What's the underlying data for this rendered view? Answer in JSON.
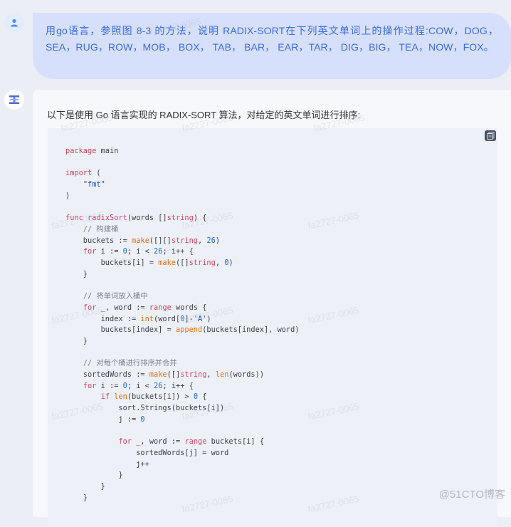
{
  "user_message": {
    "avatar_icon": "user-icon",
    "text": "用go语言，参照图 8-3 的方法，说明 RADIX-SORT在下列英文单词上的操作过程:COW，DOG，SEA，RUG，ROW，MOB， BOX， TAB， BAR， EAR，TAR， DIG，BIG， TEA，NOW，FOX。"
  },
  "bot_message": {
    "avatar_icon": "ai-logo-icon",
    "intro": "以下是使用 Go 语言实现的 RADIX-SORT 算法，对给定的英文单词进行排序:",
    "code": {
      "language": "go",
      "copy_icon": "copy-icon",
      "lines": [
        "package main",
        "",
        "import (",
        "    \"fmt\"",
        ")",
        "",
        "func radixSort(words []string) {",
        "    // 构建桶",
        "    buckets := make([][]string, 26)",
        "    for i := 0; i < 26; i++ {",
        "        buckets[i] = make([]string, 0)",
        "    }",
        "",
        "    // 将单词放入桶中",
        "    for _, word := range words {",
        "        index := int(word[0]-'A')",
        "        buckets[index] = append(buckets[index], word)",
        "    }",
        "",
        "    // 对每个桶进行排序并合并",
        "    sortedWords := make([]string, len(words))",
        "    for i := 0; i < 26; i++ {",
        "        if len(buckets[i]) > 0 {",
        "            sort.Strings(buckets[i])",
        "            j := 0",
        "",
        "            for _, word := range buckets[i] {",
        "                sortedWords[j] = word",
        "                j++",
        "            }",
        "        }",
        "    }"
      ]
    }
  },
  "watermark": {
    "repeat_text": "fa2727-0065",
    "site": "@51CTO博客"
  },
  "colors": {
    "page_bg": "#eceef5",
    "user_bubble_bg": "#d6e0fc",
    "user_text": "#3b6ae0",
    "keyword": "#d6455c",
    "builtin": "#e8700d",
    "number": "#1f6fcf"
  }
}
